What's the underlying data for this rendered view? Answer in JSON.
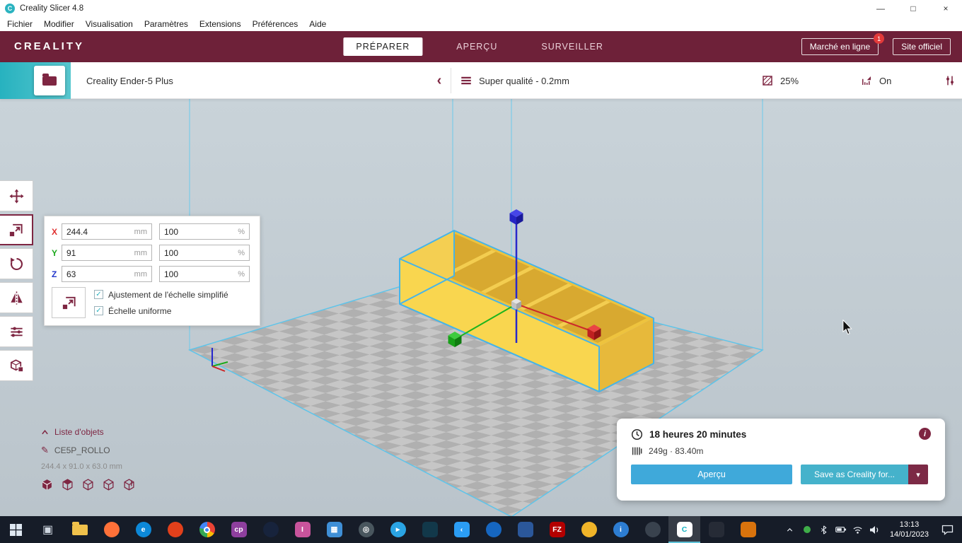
{
  "colors": {
    "brand-maroon": "#7E2642",
    "header-bg": "#6E2139",
    "teal": "#2BB3C0",
    "button-blue": "#3FA9DA",
    "button-teal": "#45B2CB",
    "selection-blue": "#46B4E8",
    "model-yellow": "#F8D24E",
    "taskbar-bg": "#161C28"
  },
  "window": {
    "app_icon_glyph": "C",
    "title": "Creality Slicer 4.8",
    "minimize_glyph": "—",
    "maximize_glyph": "□",
    "close_glyph": "×"
  },
  "menubar": {
    "items": [
      "Fichier",
      "Modifier",
      "Visualisation",
      "Paramètres",
      "Extensions",
      "Préférences",
      "Aide"
    ]
  },
  "header": {
    "brand": "CREALITY",
    "tabs": [
      {
        "label": "PRÉPARER",
        "active": true
      },
      {
        "label": "APERÇU",
        "active": false
      },
      {
        "label": "SURVEILLER",
        "active": false
      }
    ],
    "marketplace_label": "Marché en ligne",
    "marketplace_badge": "1",
    "official_label": "Site officiel"
  },
  "toolbar": {
    "printer_name": "Creality Ender-5 Plus",
    "collapse_icon": "‹",
    "quality_label": "Super qualité - 0.2mm",
    "infill_value": "25%",
    "support_value": "On"
  },
  "tools": {
    "items": [
      {
        "name": "move",
        "active": false
      },
      {
        "name": "scale",
        "active": true
      },
      {
        "name": "rotate",
        "active": false
      },
      {
        "name": "mirror",
        "active": false
      },
      {
        "name": "per-model-settings",
        "active": false
      },
      {
        "name": "support-blocker",
        "active": false
      }
    ]
  },
  "scale_panel": {
    "rows": [
      {
        "axis": "X",
        "value": "244.4",
        "unit": "mm",
        "percent": "100",
        "punit": "%"
      },
      {
        "axis": "Y",
        "value": "91",
        "unit": "mm",
        "percent": "100",
        "punit": "%"
      },
      {
        "axis": "Z",
        "value": "63",
        "unit": "mm",
        "percent": "100",
        "punit": "%"
      }
    ],
    "simplified_label": "Ajustement de l'échelle simplifié",
    "uniform_label": "Échelle uniforme",
    "check_glyph": "✓"
  },
  "object_list": {
    "title": "Liste d'objets",
    "pencil_glyph": "✎",
    "object_name": "CE5P_ROLLO",
    "dimensions": "244.4 x 91.0 x 63.0 mm"
  },
  "job_panel": {
    "print_time": "18 heures 20 minutes",
    "material_usage": "249g · 83.40m",
    "info_glyph": "i",
    "preview_label": "Aperçu",
    "save_label": "Save as Creality for...",
    "dropdown_glyph": "▾"
  },
  "taskbar": {
    "clock_time": "13:13",
    "clock_date": "14/01/2023",
    "tray_icons": [
      "hidden-icons",
      "green-status",
      "bluetooth",
      "battery",
      "wifi",
      "volume"
    ],
    "apps": [
      {
        "name": "start",
        "glyph": "",
        "shape": "special"
      },
      {
        "name": "task-view",
        "glyph": "▣",
        "fg": "#cfd6e0",
        "shape": "plain"
      },
      {
        "name": "file-explorer",
        "glyph": "",
        "bg": "#f0c14b",
        "shape": "folder"
      },
      {
        "name": "firefox",
        "glyph": "",
        "bg": "#ff7139",
        "shape": "circle"
      },
      {
        "name": "edge",
        "glyph": "e",
        "bg": "#0c88d8",
        "fg": "#fff",
        "shape": "circle"
      },
      {
        "name": "brave",
        "glyph": "",
        "bg": "#e2401b",
        "shape": "circle"
      },
      {
        "name": "chrome",
        "glyph": "",
        "shape": "chrome"
      },
      {
        "name": "cp-editor",
        "glyph": "cp",
        "bg": "#8e3f9e",
        "fg": "#fff",
        "shape": "square"
      },
      {
        "name": "steam",
        "glyph": "",
        "bg": "#17233c",
        "shape": "circle"
      },
      {
        "name": "pink-app",
        "glyph": "I",
        "bg": "#c8549c",
        "fg": "#fff",
        "shape": "square"
      },
      {
        "name": "calculator",
        "glyph": "▦",
        "bg": "#3f8fd6",
        "fg": "#fff",
        "shape": "square"
      },
      {
        "name": "obs",
        "glyph": "◎",
        "bg": "#49565e",
        "fg": "#fff",
        "shape": "circle"
      },
      {
        "name": "telegram",
        "glyph": "▸",
        "bg": "#2aa4e4",
        "fg": "#fff",
        "shape": "circle"
      },
      {
        "name": "chip-app",
        "glyph": "",
        "bg": "#12384a",
        "fg": "#59d6c9",
        "shape": "square"
      },
      {
        "name": "vscode",
        "glyph": "‹",
        "bg": "#2b9df4",
        "fg": "#fff",
        "shape": "square"
      },
      {
        "name": "blue-app",
        "glyph": "",
        "bg": "#1666c0",
        "shape": "circle"
      },
      {
        "name": "panel-app",
        "glyph": "",
        "bg": "#2b579a",
        "shape": "square"
      },
      {
        "name": "filezilla",
        "glyph": "FZ",
        "bg": "#b30000",
        "fg": "#fff",
        "shape": "square"
      },
      {
        "name": "yellow-app",
        "glyph": "",
        "bg": "#f0b429",
        "shape": "circle"
      },
      {
        "name": "info-app",
        "glyph": "i",
        "bg": "#2d7dd2",
        "fg": "#fff",
        "shape": "circle"
      },
      {
        "name": "gray-app",
        "glyph": "",
        "bg": "#39424e",
        "shape": "circle"
      },
      {
        "name": "creality-slicer",
        "glyph": "C",
        "bg": "#ffffff",
        "fg": "#12b2c0",
        "shape": "square",
        "active": true
      },
      {
        "name": "printer-app",
        "glyph": "",
        "bg": "#262b36",
        "shape": "square"
      },
      {
        "name": "orange-app",
        "glyph": "",
        "bg": "#d9730d",
        "shape": "square"
      }
    ]
  }
}
